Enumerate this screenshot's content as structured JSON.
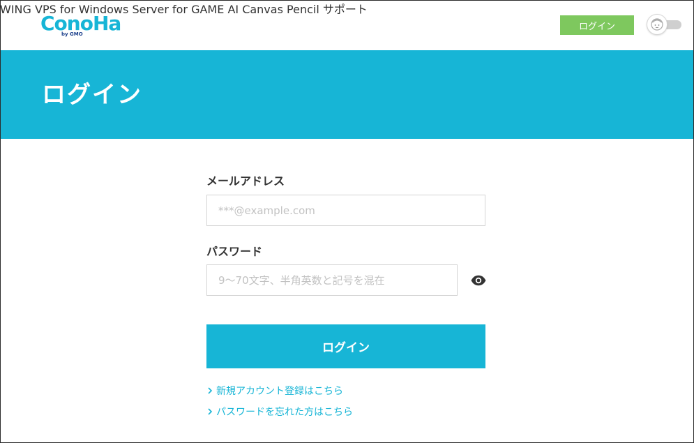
{
  "brand": {
    "logo_text": "ConoHa",
    "logo_sub": "by GMO",
    "logo_color": "#17b5d6"
  },
  "nav": {
    "items": [
      {
        "label": "WING"
      },
      {
        "label": "VPS"
      },
      {
        "label": "for Windows Server"
      },
      {
        "label": "for GAME"
      },
      {
        "label": "AI Canvas"
      },
      {
        "label": "Pencil"
      },
      {
        "label": "サポート"
      }
    ],
    "login_label": "ログイン",
    "login_color": "#7ec85e",
    "theme_toggle_icon": "avatar-face-icon"
  },
  "banner": {
    "title": "ログイン",
    "color": "#17b5d6"
  },
  "form": {
    "email_label": "メールアドレス",
    "email_placeholder": "***@example.com",
    "email_value": "",
    "password_label": "パスワード",
    "password_placeholder": "9〜70文字、半角英数と記号を混在",
    "password_value": "",
    "show_password_icon": "eye-icon",
    "submit_label": "ログイン"
  },
  "links": {
    "signup": "新規アカウント登録はこちら",
    "forgot": "パスワードを忘れた方はこちら"
  }
}
